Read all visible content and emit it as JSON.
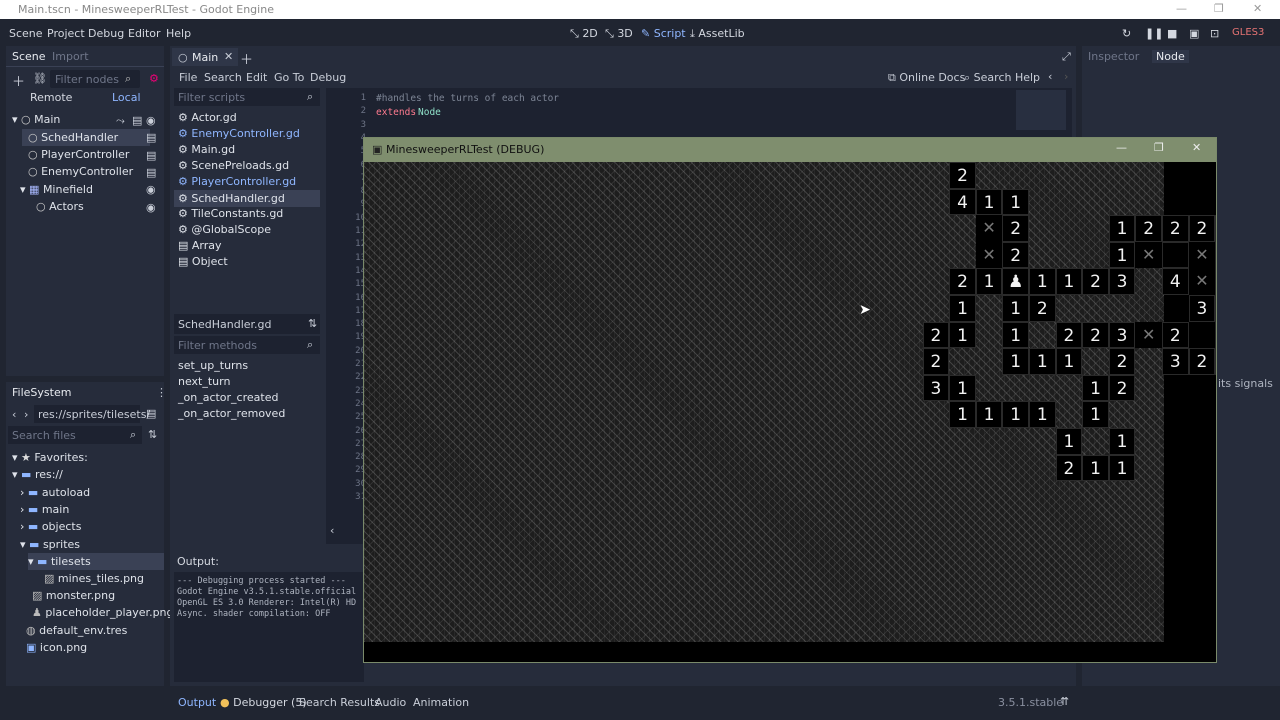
{
  "window": {
    "title": "Main.tscn - MinesweeperRLTest - Godot Engine",
    "min_icon": "—",
    "max_icon": "❐",
    "close_icon": "✕"
  },
  "menu": [
    "Scene",
    "Project",
    "Debug",
    "Editor",
    "Help"
  ],
  "modes": [
    {
      "label": "2D",
      "icon": "2d-icon"
    },
    {
      "label": "3D",
      "icon": "3d-icon"
    },
    {
      "label": "Script",
      "icon": "script-icon",
      "active": true
    },
    {
      "label": "AssetLib",
      "icon": "assetlib-icon"
    }
  ],
  "renderer": "GLES3",
  "scene_dock": {
    "tabs": [
      "Scene",
      "Import"
    ],
    "filter_placeholder": "Filter nodes",
    "remote": "Remote",
    "local": "Local",
    "nodes": [
      {
        "label": "Main",
        "depth": 0
      },
      {
        "label": "SchedHandler",
        "depth": 1,
        "selected": true
      },
      {
        "label": "PlayerController",
        "depth": 1
      },
      {
        "label": "EnemyController",
        "depth": 1
      },
      {
        "label": "Minefield",
        "depth": 1
      },
      {
        "label": "Actors",
        "depth": 2
      }
    ]
  },
  "filesystem": {
    "title": "FileSystem",
    "path": "res://sprites/tilesets/",
    "search_placeholder": "Search files",
    "items": [
      {
        "label": "Favorites:",
        "depth": 0
      },
      {
        "label": "res://",
        "depth": 0
      },
      {
        "label": "autoload",
        "depth": 1
      },
      {
        "label": "main",
        "depth": 1
      },
      {
        "label": "objects",
        "depth": 1
      },
      {
        "label": "sprites",
        "depth": 1
      },
      {
        "label": "tilesets",
        "depth": 2,
        "selected": true
      },
      {
        "label": "mines_tiles.png",
        "depth": 3
      },
      {
        "label": "monster.png",
        "depth": 2
      },
      {
        "label": "placeholder_player.png",
        "depth": 2
      },
      {
        "label": "default_env.tres",
        "depth": 1
      },
      {
        "label": "icon.png",
        "depth": 1
      }
    ]
  },
  "script_editor": {
    "tab": "Main",
    "menus": [
      "File",
      "Search",
      "Edit",
      "Go To",
      "Debug"
    ],
    "online_docs": "Online Docs",
    "search_help": "Search Help",
    "filter_scripts": "Filter scripts",
    "scripts": [
      "Actor.gd",
      "EnemyController.gd",
      "Main.gd",
      "ScenePreloads.gd",
      "PlayerController.gd",
      "SchedHandler.gd",
      "TileConstants.gd",
      "@GlobalScope",
      "Array",
      "Object"
    ],
    "current_script": "SchedHandler.gd",
    "filter_methods": "Filter methods",
    "methods": [
      "set_up_turns",
      "next_turn",
      "_on_actor_created",
      "_on_actor_removed"
    ],
    "line_numbers": [
      "1",
      "2",
      "3",
      "4",
      "5",
      "6",
      "7",
      "8",
      "9",
      "10",
      "11",
      "12",
      "13",
      "14",
      "15",
      "16",
      "17",
      "18",
      "19",
      "20",
      "21",
      "22",
      "23",
      "24",
      "25",
      "26",
      "27",
      "28",
      "29",
      "30",
      "31"
    ],
    "code_line_1": "#handles the turns of each actor",
    "code_line_2_kw": "extends",
    "code_line_2_rest": "Node"
  },
  "inspector": {
    "tabs": [
      "Inspector",
      "Node"
    ],
    "partial_text": "its signals"
  },
  "output": {
    "title": "Output:",
    "lines": [
      "--- Debugging process started ---",
      "Godot Engine v3.5.1.stable.official",
      "OpenGL ES 3.0 Renderer: Intel(R) HD",
      "Async. shader compilation: OFF"
    ]
  },
  "bottom_tabs": [
    "Output",
    "Debugger (5)",
    "Search Results",
    "Audio",
    "Animation"
  ],
  "version": "3.5.1.stable",
  "game_window": {
    "title": "MinesweeperRLTest (DEBUG)",
    "board": [
      "......................2..........2x.......",
      "......................411.........2x323...",
      ".......................x2...12221111xx....",
      ".......................x2...1x x21.1221...",
      "......................21P1123.4x1....1....",
      "......................1.12.....31211..2...",
      ".....................21.1.223x2.1x3212....",
      ".....................2..111.2.3233xx11....",
      ".....................31....12.......211...",
      "......................1111.1..............",
      "..........................1.1.............",
      "..........................211.............."
    ]
  }
}
